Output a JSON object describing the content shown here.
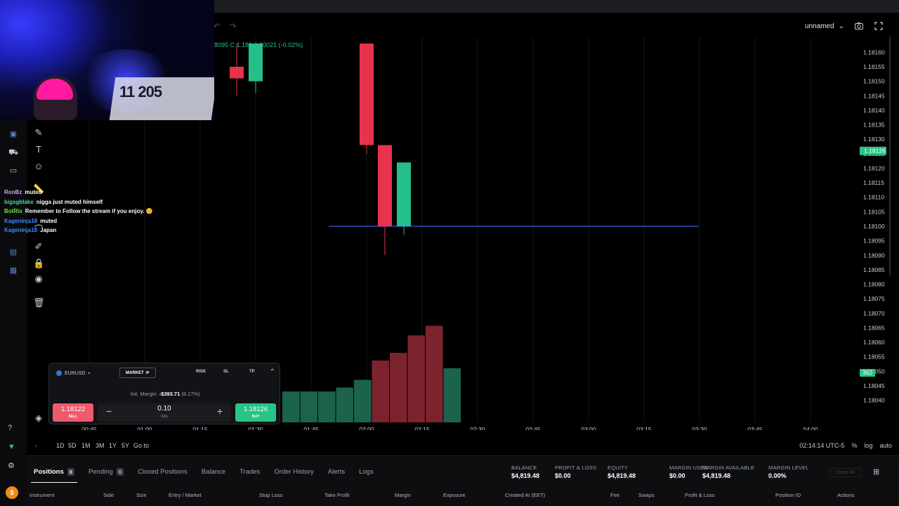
{
  "header": {
    "layout_name": "unnamed",
    "camera_icon": "camera-icon",
    "fullscreen_icon": "fullscreen-icon",
    "ohlc_text": "8095  C 1.181  0.00021 (-0.02%)"
  },
  "chart_data": {
    "type": "candlestick",
    "y_ticks": [
      "1.18160",
      "1.18155",
      "1.18150",
      "1.18145",
      "1.18140",
      "1.18135",
      "1.18130",
      "1.18125",
      "1.18120",
      "1.18115",
      "1.18110",
      "1.18105",
      "1.18100",
      "1.18095",
      "1.18090",
      "1.18085",
      "1.18080",
      "1.18075",
      "1.18070",
      "1.18065",
      "1.18060",
      "1.18055",
      "1.18050",
      "1.18045",
      "1.18040"
    ],
    "ylim": [
      1.18037,
      1.18163
    ],
    "x_ticks": [
      "00:45",
      "01:00",
      "01:15",
      "01:30",
      "01:45",
      "02:00",
      "02:15",
      "02:30",
      "02:45",
      "03:00",
      "03:15",
      "03:30",
      "03:45",
      "04:00"
    ],
    "current_price_label": "1.18126",
    "volume_label": "362",
    "horizontal_line_price": 1.181,
    "candles": [
      {
        "t": "01:30a",
        "open": 1.18155,
        "high": 1.18163,
        "low": 1.18145,
        "close": 1.18151,
        "dir": "down"
      },
      {
        "t": "01:30b",
        "open": 1.1815,
        "high": 1.18163,
        "low": 1.18146,
        "close": 1.18163,
        "dir": "up"
      },
      {
        "t": "02:00a",
        "open": 1.18163,
        "high": 1.18163,
        "low": 1.18125,
        "close": 1.18128,
        "dir": "down"
      },
      {
        "t": "02:05",
        "open": 1.18128,
        "high": 1.18128,
        "low": 1.1809,
        "close": 1.181,
        "dir": "down"
      },
      {
        "t": "02:10",
        "open": 1.181,
        "high": 1.1812,
        "low": 1.18097,
        "close": 1.18122,
        "dir": "up"
      }
    ],
    "volume_bars": [
      {
        "x": 1,
        "v": 22,
        "dir": "down"
      },
      {
        "x": 2,
        "v": 22,
        "dir": "up"
      },
      {
        "x": 3,
        "v": 22,
        "dir": "down"
      },
      {
        "x": 4,
        "v": 16,
        "dir": "up"
      },
      {
        "x": 5,
        "v": 16,
        "dir": "up"
      },
      {
        "x": 6,
        "v": 16,
        "dir": "up"
      },
      {
        "x": 7,
        "v": 18,
        "dir": "up"
      },
      {
        "x": 8,
        "v": 22,
        "dir": "up"
      },
      {
        "x": 9,
        "v": 32,
        "dir": "down"
      },
      {
        "x": 10,
        "v": 36,
        "dir": "down"
      },
      {
        "x": 11,
        "v": 45,
        "dir": "down"
      },
      {
        "x": 12,
        "v": 50,
        "dir": "down"
      },
      {
        "x": 13,
        "v": 28,
        "dir": "up"
      }
    ]
  },
  "chat": [
    {
      "user": "RonBz",
      "color": "#c9a6ff",
      "text": "muted"
    },
    {
      "user": "bigsgblake",
      "color": "#4ad6a8",
      "text": "nigga just muted himself"
    },
    {
      "user": "BotRix",
      "color": "#76e04a",
      "text": "Remember to Follow the stream if you enjoy. 😊"
    },
    {
      "user": "Kageninja18",
      "color": "#3b8cff",
      "text": "muted"
    },
    {
      "user": "Kageninja18",
      "color": "#3b8cff",
      "text": "Japan"
    }
  ],
  "order_panel": {
    "pair": "EURUSD",
    "market_label": "MARKET",
    "risk_label": "RISK",
    "sl_label": "SL",
    "tp_label": "TP",
    "margin_label": "Init. Margin:",
    "margin_value": "-$393.71",
    "margin_pct": "(8.17%)",
    "sell_price": "1.18122",
    "sell_label": "SELL",
    "buy_price": "1.18126",
    "buy_label": "BUY",
    "lots_value": "0.10",
    "lots_unit": "lots"
  },
  "timebar": {
    "tf": [
      "1D",
      "5D",
      "1M",
      "3M",
      "1Y",
      "5Y"
    ],
    "goto": "Go to",
    "clock": "02:14:14 UTC-5",
    "pct": "%",
    "log": "log",
    "auto": "auto"
  },
  "bottom": {
    "tabs": [
      {
        "label": "Positions",
        "count": "0"
      },
      {
        "label": "Pending",
        "count": "0"
      },
      {
        "label": "Closed Positions"
      },
      {
        "label": "Balance"
      },
      {
        "label": "Trades"
      },
      {
        "label": "Order History"
      },
      {
        "label": "Alerts"
      },
      {
        "label": "Logs"
      }
    ],
    "stats": [
      {
        "k": "BALANCE",
        "v": "$4,819.48"
      },
      {
        "k": "PROFIT & LOSS",
        "v": "$0.00"
      },
      {
        "k": "EQUITY",
        "v": "$4,819.48"
      },
      {
        "k": "MARGIN USED",
        "v": "$0.00"
      },
      {
        "k": "MARGIN AVAILABLE",
        "v": "$4,819.48"
      },
      {
        "k": "MARGIN LEVEL",
        "v": "0.00%"
      }
    ],
    "close_all": "Close All",
    "columns": [
      "Instrument",
      "Side",
      "Size",
      "Entry / Market",
      "Stop Loss",
      "Take Profit",
      "Margin",
      "Exposure",
      "Created At (EET)",
      "Fee",
      "Swaps",
      "Profit & Loss",
      "Position ID",
      "Actions"
    ]
  },
  "webcam_text": "11 205"
}
